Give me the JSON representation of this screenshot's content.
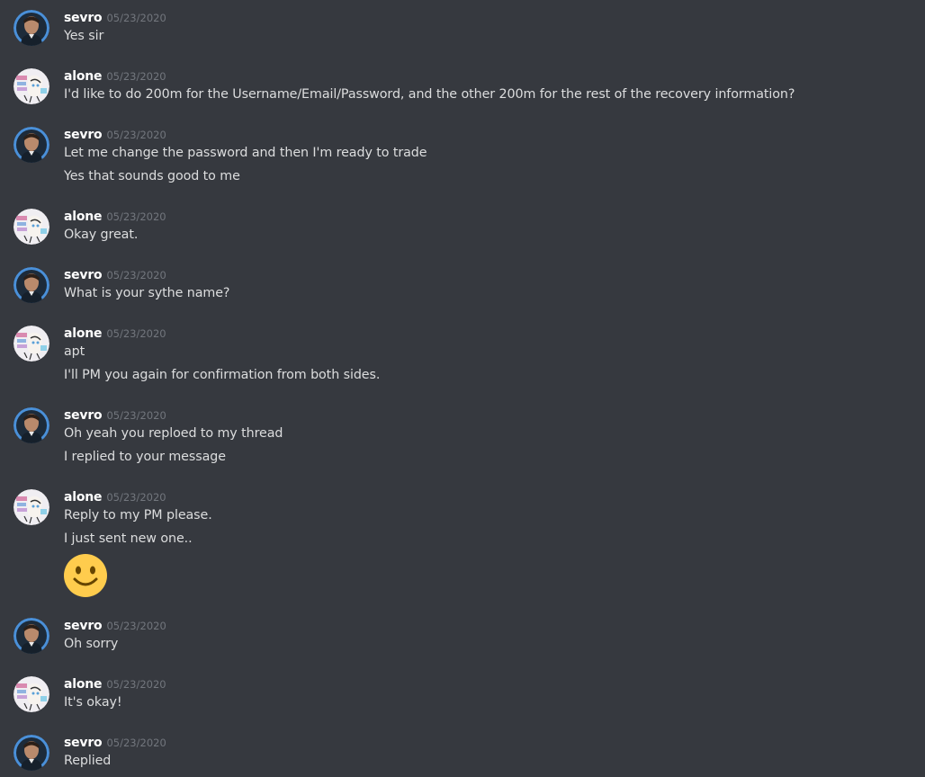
{
  "messages": [
    {
      "author": "sevro",
      "avatar": "sevro-avatar",
      "timestamp": "05/23/2020",
      "lines": [
        "Yes sir"
      ]
    },
    {
      "author": "alone",
      "avatar": "alone-avatar",
      "timestamp": "05/23/2020",
      "lines": [
        "I'd like to do 200m for the Username/Email/Password, and the other 200m for the rest of the recovery information?"
      ]
    },
    {
      "author": "sevro",
      "avatar": "sevro-avatar",
      "timestamp": "05/23/2020",
      "lines": [
        "Let me change the password and then I'm ready to trade",
        "Yes that sounds good to me"
      ]
    },
    {
      "author": "alone",
      "avatar": "alone-avatar",
      "timestamp": "05/23/2020",
      "lines": [
        "Okay great."
      ]
    },
    {
      "author": "sevro",
      "avatar": "sevro-avatar",
      "timestamp": "05/23/2020",
      "lines": [
        "What is your sythe name?"
      ]
    },
    {
      "author": "alone",
      "avatar": "alone-avatar",
      "timestamp": "05/23/2020",
      "lines": [
        "apt",
        "I'll PM you again for confirmation from both sides."
      ]
    },
    {
      "author": "sevro",
      "avatar": "sevro-avatar",
      "timestamp": "05/23/2020",
      "lines": [
        "Oh yeah you reploed to my thread",
        "I replied to your message"
      ]
    },
    {
      "author": "alone",
      "avatar": "alone-avatar",
      "timestamp": "05/23/2020",
      "lines": [
        "Reply to my PM please.",
        "I just sent new one.."
      ],
      "emoji": "slightly-smiling-face-icon"
    },
    {
      "author": "sevro",
      "avatar": "sevro-avatar",
      "timestamp": "05/23/2020",
      "lines": [
        "Oh sorry"
      ]
    },
    {
      "author": "alone",
      "avatar": "alone-avatar",
      "timestamp": "05/23/2020",
      "lines": [
        "It's okay!"
      ]
    },
    {
      "author": "sevro",
      "avatar": "sevro-avatar",
      "timestamp": "05/23/2020",
      "lines": [
        "Replied"
      ]
    }
  ],
  "colors": {
    "background": "#36393f",
    "username": "#ffffff",
    "timestamp": "#72767d",
    "text": "#dcddde",
    "sevro_avatar_ring": "#4a90d9",
    "emoji": "#ffcc4d"
  }
}
